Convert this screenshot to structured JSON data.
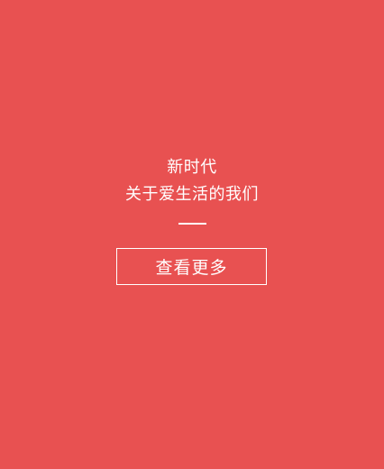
{
  "panel": {
    "background": "#e85151",
    "title_line1": "新时代",
    "title_line2": "关于爱生活的我们",
    "button_label": "查看更多"
  }
}
